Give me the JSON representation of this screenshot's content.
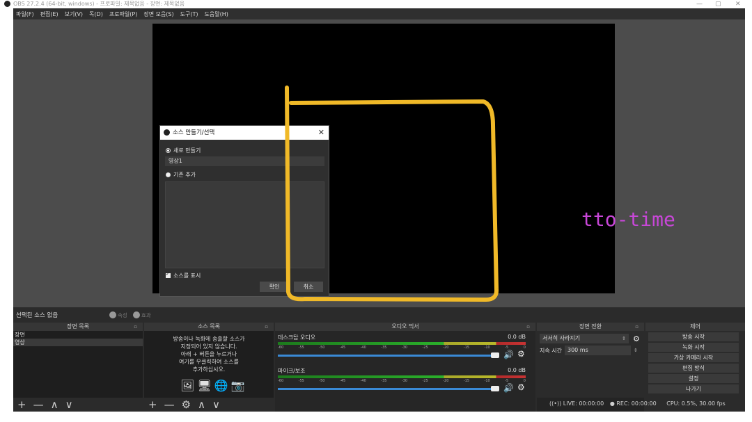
{
  "window": {
    "title": "OBS 27.2.4 (64-bit, windows) - 프로파일: 제목없음 - 장면: 제목없음",
    "min": "—",
    "max": "▢",
    "close": "✕"
  },
  "menu": [
    "파일(F)",
    "편집(E)",
    "보기(V)",
    "독(D)",
    "프로파일(P)",
    "장면 모음(S)",
    "도구(T)",
    "도움말(H)"
  ],
  "dialog": {
    "title": "소스 만들기/선택",
    "close": "✕",
    "create_new_label": "새로 만들기",
    "name_value": "영상1",
    "add_existing_label": "기존 추가",
    "visible_label": "소스를 표시",
    "ok_label": "확인",
    "cancel_label": "취소"
  },
  "watermark": "tto-time",
  "status_strip": {
    "label": "선택된 소스 없음",
    "props_label": "속성",
    "filters_label": "효과"
  },
  "scenes": {
    "title": "장면 목록",
    "items": [
      "장면",
      "영상"
    ],
    "foot": [
      "+",
      "—",
      "∧",
      "∨"
    ]
  },
  "sources": {
    "title": "소스 목록",
    "hint": [
      "방송이나 녹화에 송출할 소스가",
      "지정되어 있지 않습니다.",
      "아래 + 버튼을 누르거나",
      "여기를 우클릭하여 소스를",
      "추가하십시오."
    ],
    "icons": [
      "🖼",
      "🖥",
      "🌐",
      "📷"
    ],
    "foot": [
      "+",
      "—",
      "⚙",
      "∧",
      "∨"
    ]
  },
  "mixer": {
    "title": "오디오 믹서",
    "tracks": [
      {
        "name": "데스크탑 오디오",
        "db": "0.0 dB"
      },
      {
        "name": "마이크/보조",
        "db": "0.0 dB"
      }
    ],
    "ticks": [
      "-60",
      "-55",
      "-50",
      "-45",
      "-40",
      "-35",
      "-30",
      "-25",
      "-20",
      "-15",
      "-10",
      "-5",
      "0"
    ],
    "speaker_icon": "🔊",
    "gear_icon": "⚙"
  },
  "transitions": {
    "title": "장면 전환",
    "selected": "서서히 사라지기",
    "duration_label": "지속 시간",
    "duration_value": "300 ms"
  },
  "controls": {
    "title": "제어",
    "buttons": [
      "방송 시작",
      "녹화 시작",
      "가상 카메라 시작",
      "편집 방식",
      "설정",
      "나가기"
    ]
  },
  "statusbar": {
    "live": "LIVE: 00:00:00",
    "rec": "REC: 00:00:00",
    "cpu": "CPU: 0.5%, 30.00 fps"
  }
}
